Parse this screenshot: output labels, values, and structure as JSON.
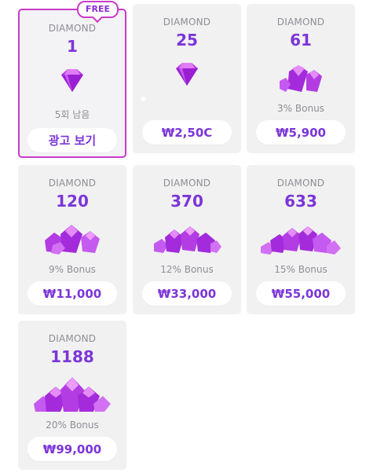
{
  "colors": {
    "accent": "#7b36d8",
    "free_border": "#c93bc9",
    "card_bg": "#f1f1f2"
  },
  "cards": [
    {
      "category": "DIAMOND",
      "amount": "1",
      "sub": "5회 남음",
      "button": "광고 보기",
      "badge": "FREE",
      "gem": "single-gem-icon"
    },
    {
      "category": "DIAMOND",
      "amount": "25",
      "sub": "",
      "button": "₩2,50C",
      "gem": "single-gem-icon"
    },
    {
      "category": "DIAMOND",
      "amount": "61",
      "sub": "3% Bonus",
      "button": "₩5,900",
      "gem": "gem-small-pile-icon"
    },
    {
      "category": "DIAMOND",
      "amount": "120",
      "sub": "9% Bonus",
      "button": "₩11,000",
      "gem": "gem-pile-icon"
    },
    {
      "category": "DIAMOND",
      "amount": "370",
      "sub": "12% Bonus",
      "button": "₩33,000",
      "gem": "gem-pile-large-icon"
    },
    {
      "category": "DIAMOND",
      "amount": "633",
      "sub": "15% Bonus",
      "button": "₩55,000",
      "gem": "gem-pile-xl-icon"
    },
    {
      "category": "DIAMOND",
      "amount": "1188",
      "sub": "20% Bonus",
      "button": "₩99,000",
      "gem": "gem-mound-icon"
    }
  ]
}
